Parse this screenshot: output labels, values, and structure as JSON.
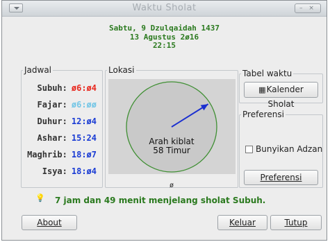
{
  "window": {
    "title": "Waktu Sholat"
  },
  "header": {
    "hijri_date": "Sabtu, 9 Dzulqaidah 1437",
    "gregorian_date": "13 Agustus 2ø16",
    "time": "22:15"
  },
  "jadwal": {
    "legend": "Jadwal",
    "prayers": [
      {
        "name": "Subuh:",
        "time": "ø6:ø4",
        "color": "#e8281e"
      },
      {
        "name": "Fajar:",
        "time": "ø6:øø",
        "color": "#74c6e6"
      },
      {
        "name": "Duhur:",
        "time": "12:ø4",
        "color": "#1a3cd4"
      },
      {
        "name": "Ashar:",
        "time": "15:24",
        "color": "#1a3cd4"
      },
      {
        "name": "Maghrib:",
        "time": "18:ø7",
        "color": "#1a3cd4"
      },
      {
        "name": "Isya:",
        "time": "18:ø4",
        "color": "#1a3cd4"
      }
    ]
  },
  "lokasi": {
    "legend": "Lokasi",
    "kiblat_label": "Arah kiblat",
    "kiblat_value": "58 Timur",
    "bottom_value": "ø",
    "direction_degrees": 58
  },
  "tabel_waktu": {
    "legend": "Tabel waktu",
    "kalender_button": "Kalender Sholat"
  },
  "preferensi": {
    "legend": "Preferensi",
    "checkbox_label": "Bunyikan Adzan",
    "checked": false,
    "button": "Preferensi"
  },
  "status": {
    "message": "7 jam dan 49 menit menjelang sholat Subuh."
  },
  "buttons": {
    "about": "About",
    "keluar": "Keluar",
    "tutup": "Tutup"
  },
  "colors": {
    "accent_green": "#2b7a1f",
    "arrow_blue": "#1a2fd0"
  }
}
